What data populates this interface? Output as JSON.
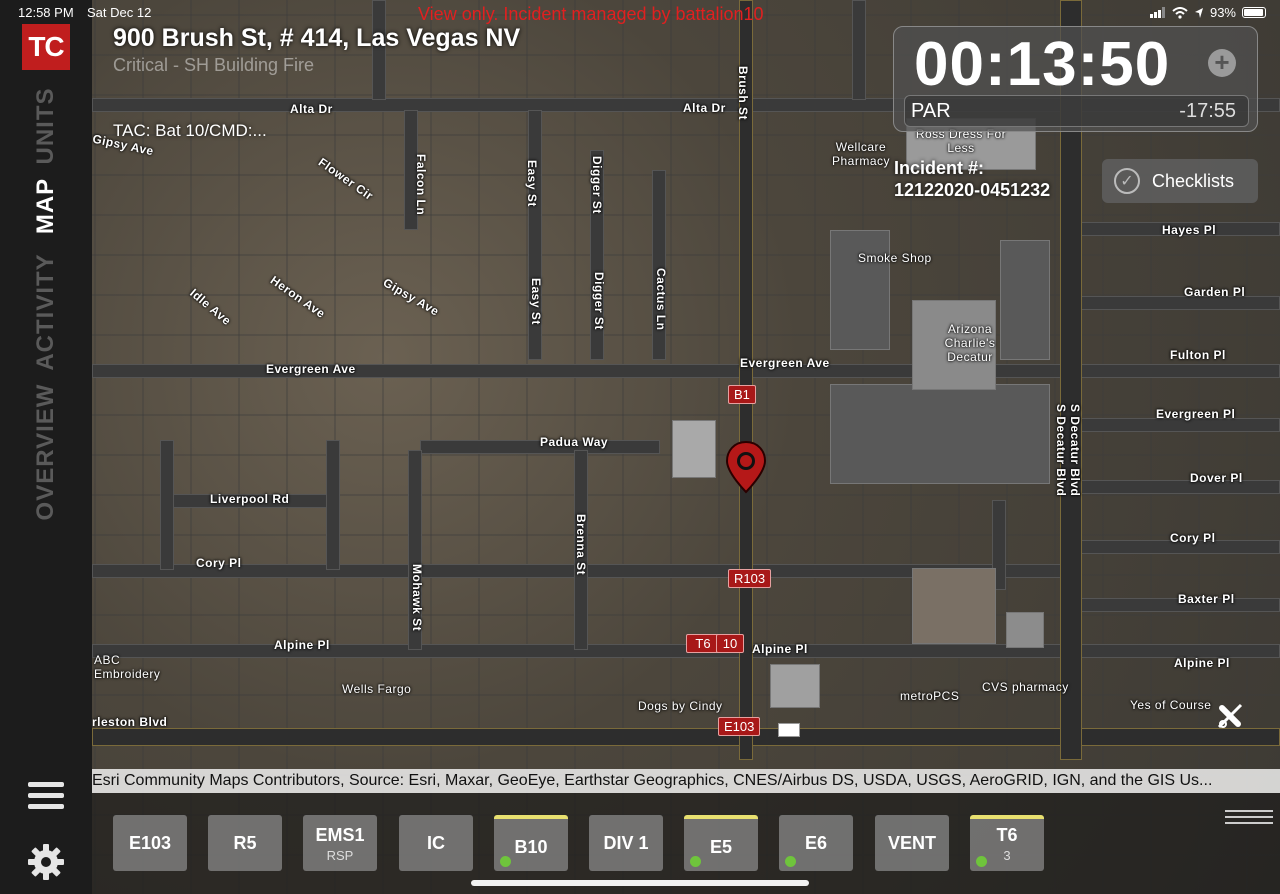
{
  "status_bar": {
    "time": "12:58 PM",
    "date": "Sat Dec 12",
    "battery": "93%"
  },
  "app": {
    "logo": "TC",
    "nav_tabs": [
      "UNITS",
      "MAP",
      "ACTIVITY",
      "OVERVIEW"
    ],
    "active_tab": "MAP"
  },
  "header": {
    "view_only": "View only. Incident managed by battalion10",
    "address": "900 Brush St, # 414, Las Vegas NV",
    "incident_type": "Critical - SH Building Fire",
    "tac": "TAC: Bat 10/CMD:..."
  },
  "timer_panel": {
    "elapsed": "00:13:50",
    "add_label": "+",
    "par_label": "PAR",
    "par_timer": "-17:55"
  },
  "incident": {
    "label": "Incident #:",
    "number": "12122020-0451232"
  },
  "checklists": {
    "label": "Checklists"
  },
  "map": {
    "streets": {
      "alta_left": "Alta Dr",
      "alta_right": "Alta Dr",
      "gipsy_left": "Gipsy Ave",
      "flower": "Flower Cir",
      "falcon": "Falcon Ln",
      "easy_top": "Easy St",
      "digger_top": "Digger St",
      "brush_top": "Brush St",
      "heron": "Heron Ave",
      "gipsy": "Gipsy Ave",
      "idle": "Idle Ave",
      "easy": "Easy St",
      "digger": "Digger St",
      "cactus": "Cactus Ln",
      "evergreen": "Evergreen Ave",
      "evergreen_mid": "Evergreen Ave",
      "padua": "Padua Way",
      "liverpool": "Liverpool Rd",
      "brenna": "Brenna St",
      "cory": "Cory Pl",
      "mohawk": "Mohawk St",
      "alpine": "Alpine Pl",
      "alpine_mid": "Alpine Pl",
      "charleston": "rleston Blvd",
      "hayes": "Hayes Pl",
      "garden": "Garden Pl",
      "fulton": "Fulton Pl",
      "evergreen_pl": "Evergreen Pl",
      "dover": "Dover Pl",
      "cory_pl": "Cory Pl",
      "baxter": "Baxter Pl",
      "alpine_pl": "Alpine Pl",
      "decatur1": "S Decatur Blvd",
      "decatur2": "S Decatur Blvd",
      "wellcare": "Wellcare Pharmacy",
      "ross": "Ross Dress For Less",
      "smoke": "Smoke Shop",
      "arizona": "Arizona Charlie's Decatur",
      "wells": "Wells Fargo",
      "dogs": "Dogs by Cindy",
      "metro": "metroPCS",
      "cvs": "CVS pharmacy",
      "yes": "Yes of Course",
      "abc": "ABC Embroidery"
    },
    "units": [
      "B1",
      "R103",
      "T6",
      "10",
      "E103"
    ]
  },
  "attribution": "Esri Community Maps Contributors, Source: Esri, Maxar, GeoEye, Earthstar Geographics, CNES/Airbus DS, USDA, USGS, AeroGRID, IGN, and the GIS Us...",
  "unit_tray": [
    {
      "name": "E103",
      "sub": "",
      "alert": false,
      "dot": false
    },
    {
      "name": "R5",
      "sub": "",
      "alert": false,
      "dot": false
    },
    {
      "name": "EMS1",
      "sub": "RSP",
      "alert": false,
      "dot": false
    },
    {
      "name": "IC",
      "sub": "",
      "alert": false,
      "dot": false
    },
    {
      "name": "B10",
      "sub": "",
      "alert": true,
      "dot": true
    },
    {
      "name": "DIV 1",
      "sub": "",
      "alert": false,
      "dot": false
    },
    {
      "name": "E5",
      "sub": "",
      "alert": true,
      "dot": true
    },
    {
      "name": "E6",
      "sub": "",
      "alert": false,
      "dot": true
    },
    {
      "name": "VENT",
      "sub": "",
      "alert": false,
      "dot": false
    },
    {
      "name": "T6",
      "sub": "3",
      "alert": true,
      "dot": true
    }
  ],
  "colors": {
    "brand": "#c01e1e",
    "alert_text": "#e02020",
    "unit_marker": "#a81818",
    "status_ok": "#6fc43c",
    "tray_alert": "#e8e070"
  },
  "icons": {
    "menu": "menu-icon",
    "settings": "gear-icon",
    "checklists": "check-circle-icon",
    "location": "map-pin-icon",
    "gps": "no-gps-icon",
    "wifi": "wifi-icon",
    "battery": "battery-icon"
  }
}
